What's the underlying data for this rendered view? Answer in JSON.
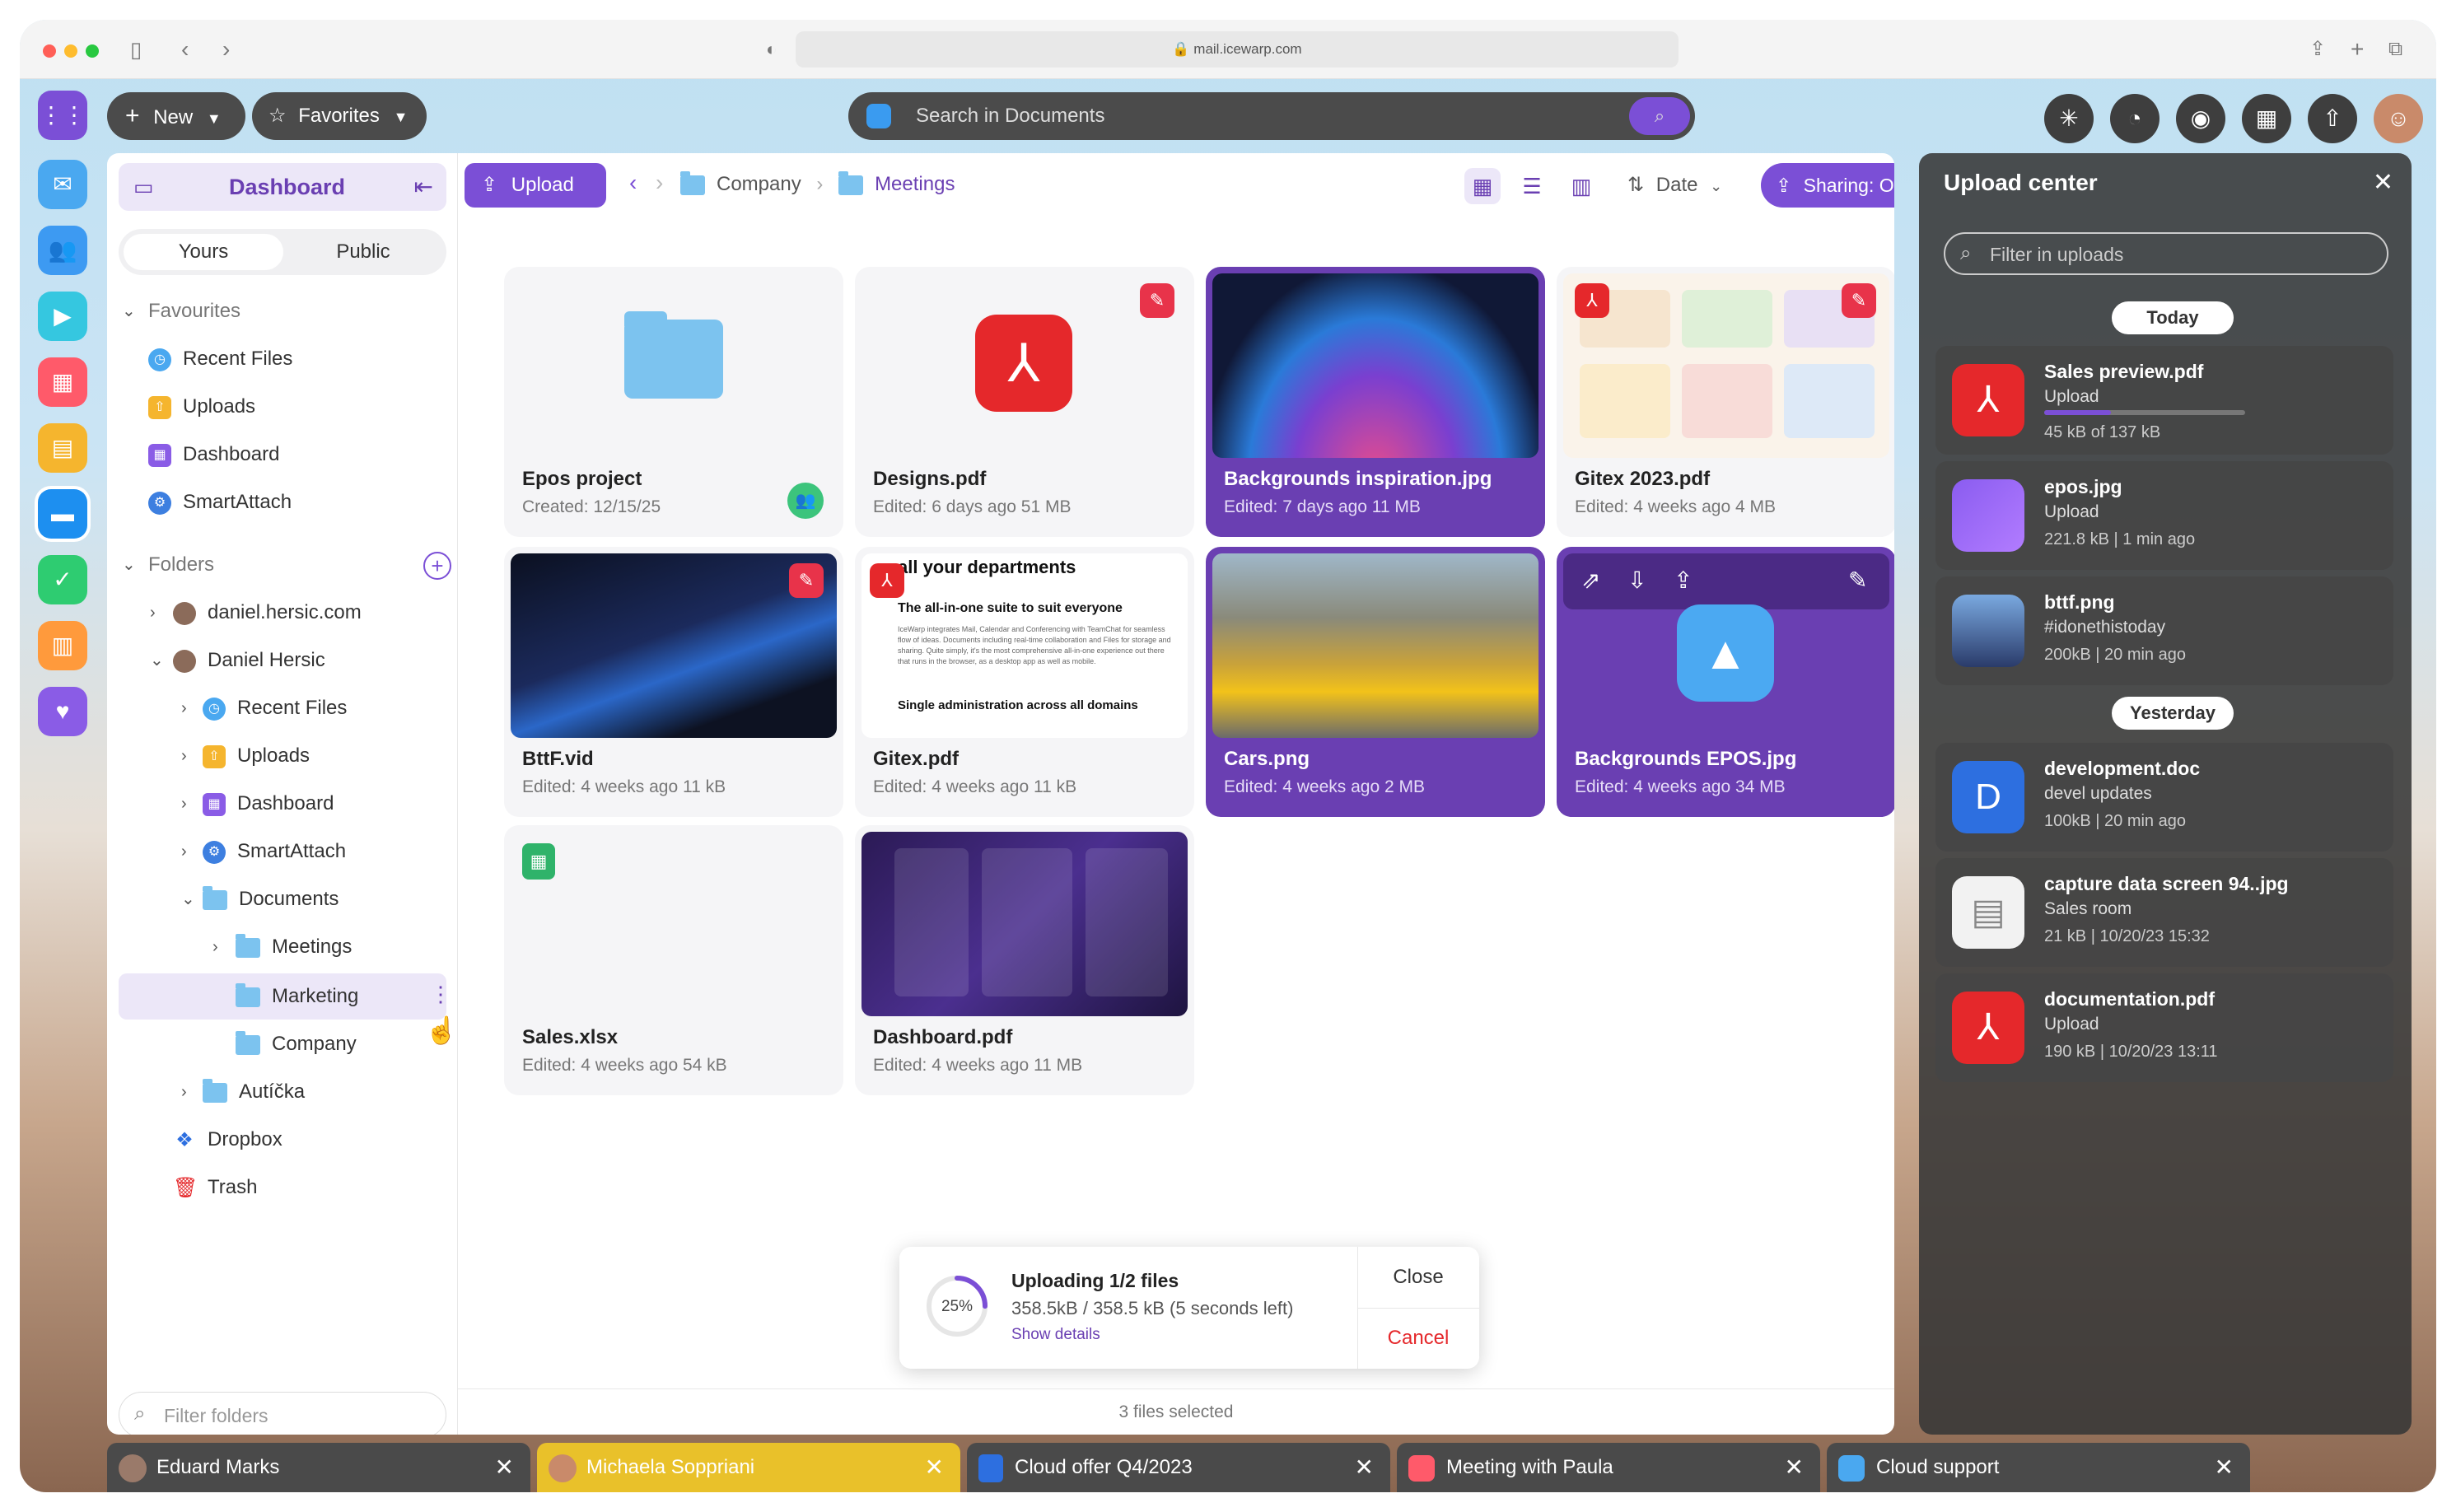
{
  "browser": {
    "url": "mail.icewarp.com"
  },
  "appbar": {
    "new_label": "New",
    "favorites_label": "Favorites",
    "search_placeholder": "Search in Documents"
  },
  "sidebar": {
    "header": "Dashboard",
    "toggle": {
      "yours": "Yours",
      "public": "Public"
    },
    "favourites_title": "Favourites",
    "favourites": [
      "Recent Files",
      "Uploads",
      "Dashboard",
      "SmartAttach"
    ],
    "folders_title": "Folders",
    "tree": {
      "account1": "daniel.hersic.com",
      "account2": "Daniel Hersic",
      "recent": "Recent Files",
      "uploads": "Uploads",
      "dashboard": "Dashboard",
      "smartattach": "SmartAttach",
      "documents": "Documents",
      "meetings": "Meetings",
      "marketing": "Marketing",
      "company": "Company",
      "auticka": "Autíčka",
      "dropbox": "Dropbox",
      "trash": "Trash"
    },
    "filter_placeholder": "Filter folders"
  },
  "toolbar": {
    "upload_label": "Upload",
    "breadcrumb": [
      "Company",
      "Meetings"
    ],
    "sort_label": "Date",
    "sharing_label": "Sharing: Off"
  },
  "files": [
    {
      "name": "Epos project",
      "meta": "Created: 12/15/25",
      "selected": false
    },
    {
      "name": "Designs.pdf",
      "meta": "Edited: 6 days ago   51 MB",
      "selected": false
    },
    {
      "name": "Backgrounds inspiration.jpg",
      "meta": "Edited: 7 days ago   11 MB",
      "selected": true
    },
    {
      "name": "Gitex 2023.pdf",
      "meta": "Edited: 4 weeks ago   4 MB",
      "selected": false
    },
    {
      "name": "BttF.vid",
      "meta": "Edited: 4 weeks ago   11 kB",
      "selected": false
    },
    {
      "name": "Gitex.pdf",
      "meta": "Edited: 4 weeks ago   11 kB",
      "selected": false
    },
    {
      "name": "Cars.png",
      "meta": "Edited: 4 weeks ago   2 MB",
      "selected": true
    },
    {
      "name": "Backgrounds EPOS.jpg",
      "meta": "Edited: 4 weeks ago   34 MB",
      "selected": true
    },
    {
      "name": "Sales.xlsx",
      "meta": "Edited: 4 weeks ago   54 kB",
      "selected": false
    },
    {
      "name": "Dashboard.pdf",
      "meta": "Edited: 4 weeks ago   11 MB",
      "selected": false
    }
  ],
  "gitex_preview": {
    "heading": "all your departments",
    "sub": "The all-in-one suite to suit everyone",
    "body": "IceWarp integrates Mail, Calendar and Conferencing with TeamChat for seamless flow of ideas. Documents including real-time collaboration and Files for storage and sharing. Quite simply, it's the most comprehensive all-in-one experience out there that runs in the browser, as a desktop app as well as mobile.",
    "footer": "Single administration across all domains"
  },
  "status": {
    "selected": "3 files selected"
  },
  "toast": {
    "percent": "25%",
    "title": "Uploading 1/2 files",
    "detail": "358.5kB / 358.5 kB (5 seconds left)",
    "link": "Show details",
    "close": "Close",
    "cancel": "Cancel",
    "progress": 0.25
  },
  "upload_center": {
    "title": "Upload center",
    "filter_placeholder": "Filter in uploads",
    "today": "Today",
    "yesterday": "Yesterday",
    "items": [
      {
        "name": "Sales preview.pdf",
        "sub": "Upload",
        "info": "45 kB of 137 kB",
        "progress": 0.33
      },
      {
        "name": "epos.jpg",
        "sub": "Upload",
        "info": "221.8 kB  |  1 min ago"
      },
      {
        "name": "bttf.png",
        "sub": "#idonethistoday",
        "info": "200kB  |  20 min ago"
      },
      {
        "name": "development.doc",
        "sub": "devel updates",
        "info": "100kB  |  20 min ago"
      },
      {
        "name": "capture data screen 94..jpg",
        "sub": "Sales room",
        "info": "21 kB  |  10/20/23 15:32"
      },
      {
        "name": "documentation.pdf",
        "sub": "Upload",
        "info": "190 kB  |  10/20/23 13:11"
      }
    ]
  },
  "taskbar": [
    "Eduard Marks",
    "Michaela Soppriani",
    "Cloud offer Q4/2023",
    "Meeting with Paula",
    "Cloud support"
  ],
  "colors": {
    "accent": "#6a3fb2",
    "pdf_red": "#e5282b",
    "folder_blue": "#7cc3ef",
    "active_tab": "#e9c12a"
  }
}
